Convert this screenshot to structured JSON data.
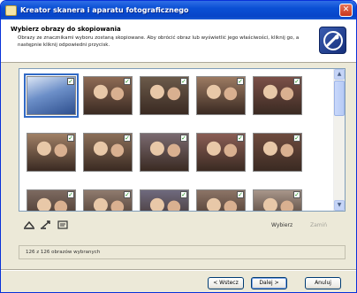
{
  "window": {
    "title": "Kreator skanera i aparatu fotograficznego",
    "close_glyph": "✕"
  },
  "header": {
    "title": "Wybierz obrazy do skopiowania",
    "subtitle": "Obrazy ze znacznikami wyboru zostaną skopiowane. Aby obrócić obraz lub wyświetlić jego właściwości, kliknij go, a następnie kliknij odpowiedni przycisk."
  },
  "scrollbar": {
    "up": "▲",
    "down": "▼"
  },
  "thumbnails": {
    "check_glyph": "✓",
    "colors": [
      "#5C7FB5",
      "#8E6B55",
      "#6B5A4A",
      "#9C7A62",
      "#7B5048",
      "#A08066",
      "#8B6F59",
      "#7A6A70",
      "#8A5E55",
      "#6E4B3E",
      "#7D6A60",
      "#8F7B6E",
      "#6F6A7E",
      "#8C7466",
      "#A8968A"
    ]
  },
  "actions": {
    "select_all": "Wybierz",
    "clear_all": "Zamiń"
  },
  "status": {
    "text": "126 z 126 obrazów wybranych"
  },
  "buttons": {
    "back": "< Wstecz",
    "next": "Dalej >",
    "cancel": "Anuluj"
  }
}
